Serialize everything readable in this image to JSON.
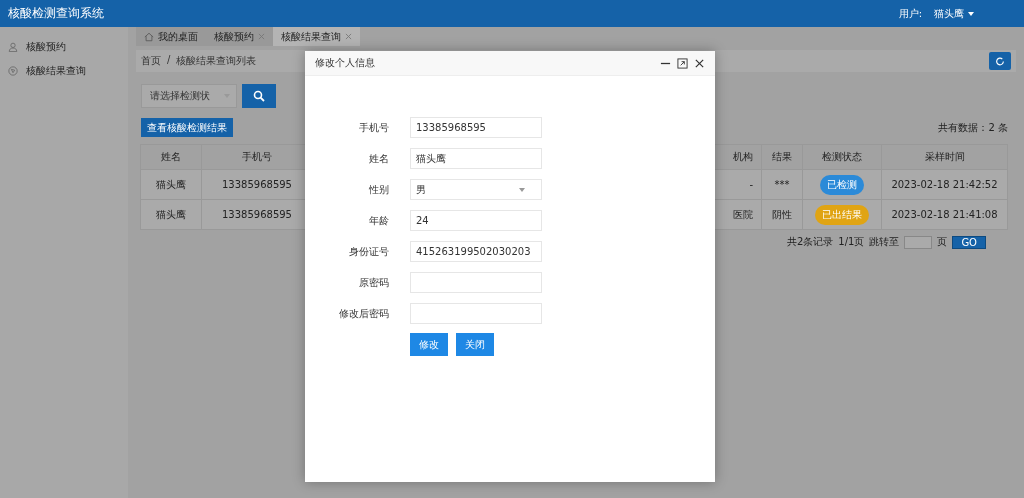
{
  "header": {
    "title": "核酸检测查询系统",
    "user_label": "用户:",
    "user_name": "猫头鹰"
  },
  "sidebar": {
    "items": [
      {
        "label": "核酸预约",
        "kind": "user",
        "selected": false
      },
      {
        "label": "核酸结果查询",
        "kind": "compass",
        "selected": false
      }
    ]
  },
  "tabs": [
    {
      "label": "我的桌面",
      "kind": "home",
      "closable": false,
      "selected": false
    },
    {
      "label": "核酸预约",
      "kind": "plain",
      "closable": true,
      "selected": false
    },
    {
      "label": "核酸结果查询",
      "kind": "plain",
      "closable": true,
      "selected": true
    }
  ],
  "breadcrumb": {
    "items": [
      "首页",
      "核酸结果查询列表"
    ],
    "separator": "/"
  },
  "filter": {
    "placeholder": "请选择检测状"
  },
  "view_button": "查看核酸检测结果",
  "total": "共有数据：2 条",
  "table": {
    "columns": [
      "姓名",
      "手机号",
      "机构",
      "结果",
      "检测状态",
      "采样时间"
    ],
    "rows": [
      {
        "cells": [
          "猫头鹰",
          "13385968595",
          "-",
          "***"
        ],
        "status": "已检测",
        "color": "#2b8ad8",
        "time": "2023-02-18 21:42:52"
      },
      {
        "cells": [
          "猫头鹰",
          "13385968595",
          "医院",
          "阴性"
        ],
        "status": "已出结果",
        "color": "#e0a413",
        "time": "2023-02-18 21:41:08"
      }
    ]
  },
  "pagination": {
    "records": "共2条记录",
    "pages": "1/1页",
    "jump_label": "跳转至",
    "page_unit": "页",
    "go": "GO"
  },
  "modal": {
    "title": "修改个人信息",
    "fields": [
      {
        "label": "手机号",
        "kind": "input",
        "value": "13385968595"
      },
      {
        "label": "姓名",
        "kind": "input",
        "value": "猫头鹰"
      },
      {
        "label": "性别",
        "kind": "select",
        "value": "男"
      },
      {
        "label": "年龄",
        "kind": "input",
        "value": "24"
      },
      {
        "label": "身份证号",
        "kind": "input",
        "value": "415263199502030203"
      },
      {
        "label": "原密码",
        "kind": "password"
      },
      {
        "label": "修改后密码",
        "kind": "password"
      }
    ],
    "buttons": [
      "修改",
      "关闭"
    ]
  }
}
